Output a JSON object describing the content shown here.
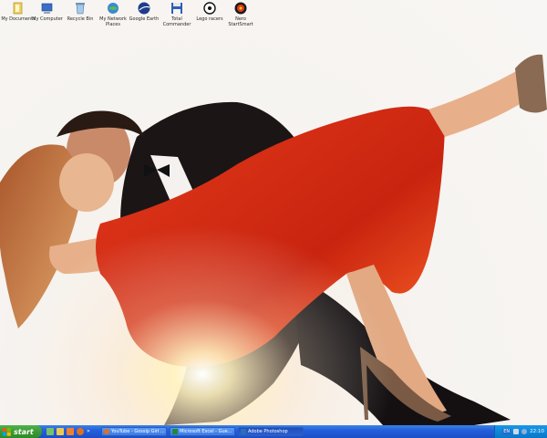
{
  "desktop": {
    "icons": [
      {
        "label": "My Documents",
        "icon": "folder-documents-icon"
      },
      {
        "label": "My Computer",
        "icon": "computer-icon"
      },
      {
        "label": "Recycle Bin",
        "icon": "recycle-bin-icon"
      },
      {
        "label": "My Network Places",
        "icon": "network-icon"
      },
      {
        "label": "Google Earth",
        "icon": "globe-icon"
      },
      {
        "label": "Total Commander",
        "icon": "floppy-disk-icon"
      },
      {
        "label": "Lego racers",
        "icon": "racing-icon"
      },
      {
        "label": "Nero StartSmart",
        "icon": "nero-icon"
      }
    ],
    "wallpaper": "couple-dancing-red-dress"
  },
  "taskbar": {
    "start_label": "start",
    "quick_launch": [
      {
        "icon": "show-desktop-icon"
      },
      {
        "icon": "folder-icon"
      },
      {
        "icon": "media-player-icon"
      },
      {
        "icon": "firefox-icon"
      },
      {
        "icon": "expand-arrow-icon"
      }
    ],
    "tasks": [
      {
        "label": "YouTube - Gossip Girl ...",
        "icon": "firefox-icon",
        "active": false
      },
      {
        "label": "Microsoft Excel - Gue...",
        "icon": "excel-icon",
        "active": false
      },
      {
        "label": "Adobe Photoshop",
        "icon": "photoshop-icon",
        "active": true
      }
    ],
    "tray": {
      "language": "EN",
      "clock": "22:10"
    }
  },
  "colors": {
    "taskbar_blue": "#245edb",
    "start_green": "#3c9a35",
    "tray_blue": "#0f86d8",
    "dress_red": "#d12a17"
  }
}
